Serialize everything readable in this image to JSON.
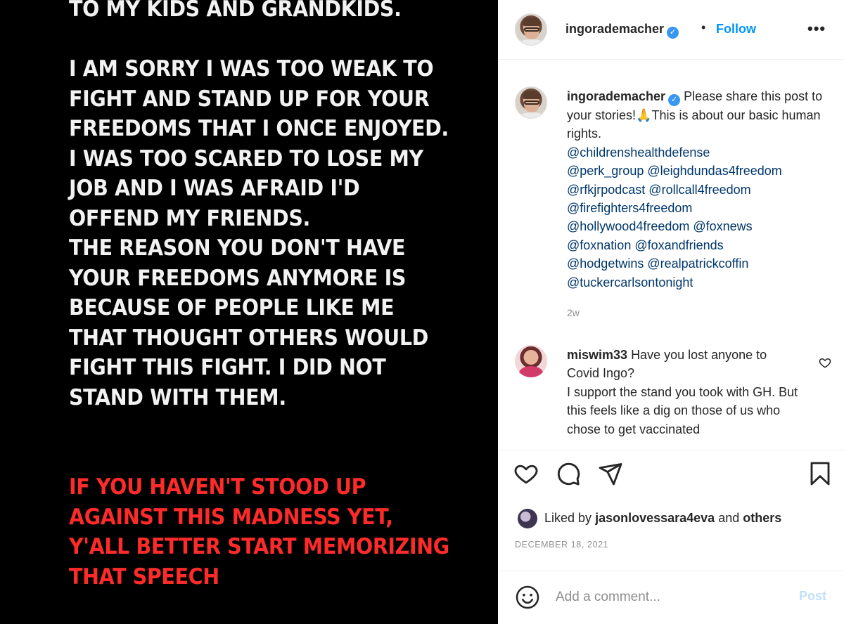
{
  "post_image": {
    "lines_white": [
      "TO MY KIDS  AND GRANDKIDS.",
      "",
      "I AM SORRY I WAS TOO WEAK TO",
      "FIGHT AND STAND UP FOR YOUR",
      "FREEDOMS THAT I ONCE ENJOYED.",
      "I WAS TOO SCARED TO LOSE MY",
      "JOB AND I WAS AFRAID I'D",
      "OFFEND MY FRIENDS.",
      "THE REASON YOU DON'T HAVE",
      "YOUR FREEDOMS ANYMORE IS",
      "BECAUSE OF PEOPLE LIKE ME",
      "THAT THOUGHT OTHERS WOULD",
      "FIGHT THIS FIGHT. I DID NOT",
      "STAND WITH THEM."
    ],
    "lines_red": [
      "IF YOU HAVEN'T STOOD UP",
      "AGAINST THIS MADNESS YET,",
      "Y'ALL BETTER START MEMORIZING",
      "THAT SPEECH"
    ]
  },
  "header": {
    "username": "ingorademacher",
    "separator": "•",
    "follow_label": "Follow",
    "more_label": "•••"
  },
  "caption": {
    "username": "ingorademacher",
    "text": "Please share this post to your stories!🙏This is about our basic human rights.",
    "mention_lines": [
      "@childrenshealthdefense",
      "@perk_group @leighdundas4freedom",
      "@rfkjrpodcast @rollcall4freedom",
      "@firefighters4freedom",
      "@hollywood4freedom @foxnews",
      "@foxnation @foxandfriends",
      "@hodgetwins @realpatrickcoffin",
      "@tuckercarlsontonight"
    ],
    "time": "2w"
  },
  "comment": {
    "username": "miswim33",
    "text": "Have you lost anyone to Covid Ingo?",
    "continuation": "I support the stand you took with GH. But this feels like a dig on those of us who chose to get vaccinated"
  },
  "actions": {
    "like_icon": "heart-icon",
    "comment_icon": "comment-bubble-icon",
    "share_icon": "paper-plane-icon",
    "save_icon": "bookmark-icon"
  },
  "likes": {
    "prefix": "Liked by",
    "user": "jasonlovessara4eva",
    "conjunction": "and",
    "others": "others"
  },
  "date": "DECEMBER 18, 2021",
  "add_comment": {
    "placeholder": "Add a comment...",
    "post_label": "Post"
  },
  "colors": {
    "accent": "#0095f6",
    "mention": "#00376b",
    "red_text": "#ff2a2a",
    "muted": "#8e8e8e"
  }
}
